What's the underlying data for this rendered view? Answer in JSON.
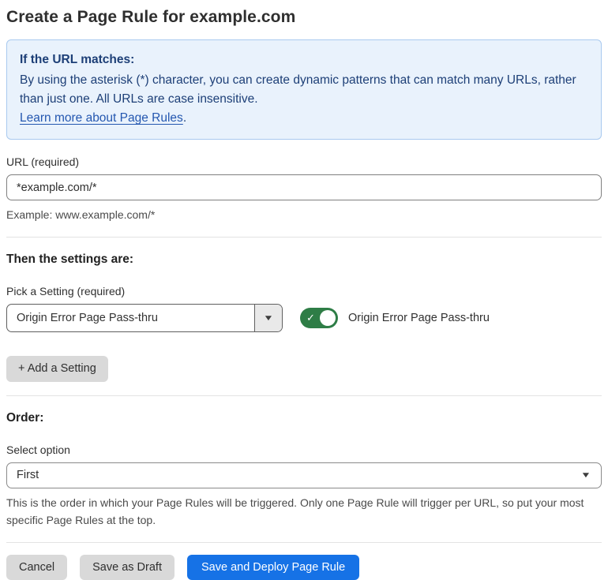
{
  "page": {
    "title": "Create a Page Rule for example.com"
  },
  "info_box": {
    "heading": "If the URL matches:",
    "body": "By using the asterisk (*) character, you can create dynamic patterns that can match many URLs, rather than just one. All URLs are case insensitive.",
    "link": "Learn more about Page Rules",
    "link_suffix": "."
  },
  "url_field": {
    "label": "URL (required)",
    "value": "*example.com/*",
    "helper": "Example: www.example.com/*"
  },
  "settings_section": {
    "heading": "Then the settings are:",
    "pick_label": "Pick a Setting (required)",
    "selected_setting": "Origin Error Page Pass-thru",
    "toggle_state": "on",
    "toggle_check_glyph": "✓",
    "toggle_label": "Origin Error Page Pass-thru",
    "add_button_label": "+ Add a Setting"
  },
  "order_section": {
    "heading": "Order:",
    "label": "Select option",
    "selected_option": "First",
    "helper": "This is the order in which your Page Rules will be triggered. Only one Page Rule will trigger per URL, so put your most specific Page Rules at the top."
  },
  "icons": {
    "chevron_down": "▼"
  },
  "footer": {
    "cancel_label": "Cancel",
    "save_draft_label": "Save as Draft",
    "save_deploy_label": "Save and Deploy Page Rule"
  },
  "colors": {
    "primary_blue": "#1672e6",
    "toggle_green": "#2e7d46",
    "info_background": "#e9f2fc",
    "info_border": "#a9c9ef",
    "info_text": "#1d3f77",
    "link_blue": "#2457b0",
    "button_gray": "#d9d9d9"
  }
}
